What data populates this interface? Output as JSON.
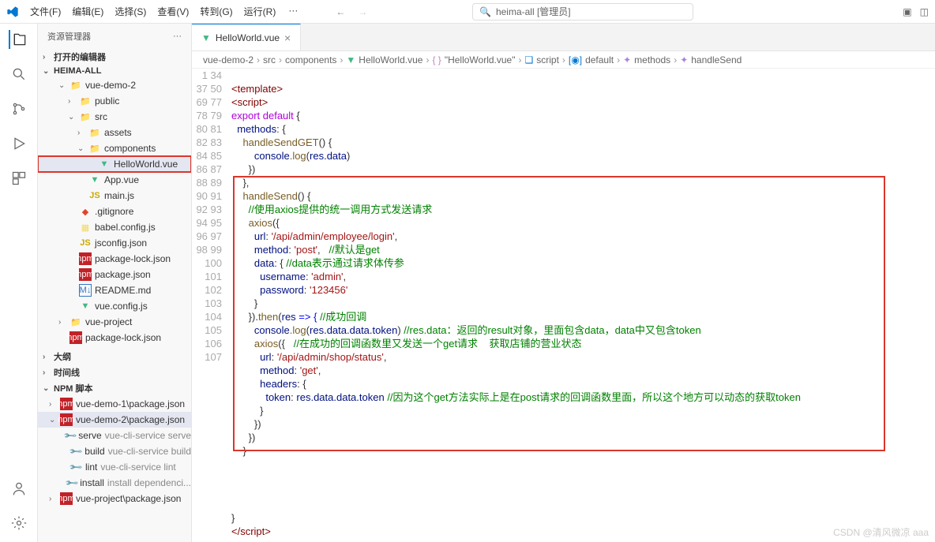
{
  "menu": {
    "file": "文件(F)",
    "edit": "编辑(E)",
    "select": "选择(S)",
    "view": "查看(V)",
    "goto": "转到(G)",
    "run": "运行(R)"
  },
  "search_box": "heima-all [管理员]",
  "sidebar": {
    "title": "资源管理器",
    "opened": "打开的编辑器",
    "project": "HEIMA-ALL",
    "outline": "大纲",
    "timeline": "时间线",
    "npm_scripts": "NPM 脚本",
    "tree": {
      "vue_demo_2": "vue-demo-2",
      "public": "public",
      "src": "src",
      "assets": "assets",
      "components": "components",
      "helloworld": "HelloWorld.vue",
      "app_vue": "App.vue",
      "main_js": "main.js",
      "gitignore": ".gitignore",
      "babel": "babel.config.js",
      "jsconfig": "jsconfig.json",
      "pkg_lock": "package-lock.json",
      "pkg": "package.json",
      "readme": "README.md",
      "vue_config": "vue.config.js",
      "vue_project": "vue-project",
      "pkg_lock2": "package-lock.json"
    },
    "npm": {
      "pkg1": "vue-demo-1\\package.json",
      "pkg2": "vue-demo-2\\package.json",
      "serve": "serve",
      "serve_d": "vue-cli-service serve",
      "build": "build",
      "build_d": "vue-cli-service build",
      "lint": "lint",
      "lint_d": "vue-cli-service lint",
      "install": "install",
      "install_d": "install dependenci...",
      "pkg3": "vue-project\\package.json"
    }
  },
  "tab": {
    "name": "HelloWorld.vue"
  },
  "breadcrumb": {
    "p1": "vue-demo-2",
    "p2": "src",
    "p3": "components",
    "p4": "HelloWorld.vue",
    "p5": "\"HelloWorld.vue\"",
    "p6": "script",
    "p7": "default",
    "p8": "methods",
    "p9": "handleSend"
  },
  "code": {
    "lines": [
      1,
      34,
      37,
      50,
      69,
      77,
      78,
      79,
      80,
      81,
      82,
      83,
      84,
      85,
      86,
      87,
      88,
      89,
      90,
      91,
      92,
      93,
      94,
      95,
      96,
      97,
      98,
      99,
      100,
      101,
      102,
      103,
      104,
      105,
      106,
      107
    ],
    "l1": "<template>",
    "l34": "<script>",
    "l37a": "export",
    "l37b": " default",
    "l37c": " {",
    "l50a": "  methods",
    "l50b": ": {",
    "l69a": "    handleSendGET",
    "l69b": "() {",
    "l77a": "        console",
    "l77b": ".log",
    "l77c": "(",
    "l77d": "res",
    "l77e": ".data",
    "l77f": ")",
    "l78": "      })",
    "l79": "    },",
    "l80a": "    handleSend",
    "l80b": "() {",
    "l81": "      //使用axios提供的统一调用方式发送请求",
    "l82a": "      axios",
    "l82b": "({",
    "l83a": "        url",
    "l83b": ": ",
    "l83c": "'/api/admin/employee/login'",
    "l83d": ",",
    "l84a": "        method",
    "l84b": ": ",
    "l84c": "'post'",
    "l84d": ",   ",
    "l84e": "//默认是get",
    "l85a": "        data",
    "l85b": ": { ",
    "l85c": "//data表示通过请求体传参",
    "l86a": "          username",
    "l86b": ": ",
    "l86c": "'admin'",
    "l86d": ",",
    "l87a": "          password",
    "l87b": ": ",
    "l87c": "'123456'",
    "l88": "        }",
    "l89a": "      }).",
    "l89b": "then",
    "l89c": "(",
    "l89d": "res",
    "l89e": " => { ",
    "l89f": "//成功回调",
    "l90a": "        console",
    "l90b": ".log",
    "l90c": "(",
    "l90d": "res",
    "l90e": ".data.data.token",
    "l90f": ") ",
    "l90g": "//res.data：返回的result对象，里面包含data，data中又包含token",
    "l91a": "        axios",
    "l91b": "({   ",
    "l91c": "//在成功的回调函数里又发送一个get请求    获取店铺的营业状态",
    "l92a": "          url",
    "l92b": ": ",
    "l92c": "'/api/admin/shop/status'",
    "l92d": ",",
    "l93a": "          method",
    "l93b": ": ",
    "l93c": "'get'",
    "l93d": ",",
    "l94a": "          headers",
    "l94b": ": {",
    "l95a": "            token",
    "l95b": ": ",
    "l95c": "res",
    "l95d": ".data.data.token ",
    "l95e": "//因为这个get方法实际上是在post请求的回调函数里面，所以这个地方可以动态的获取token",
    "l96": "          }",
    "l97": "        })",
    "l98": "      })",
    "l99": "    }",
    "l105": "}",
    "l106": "</scr"
  },
  "watermark": "CSDN @清风微凉 aaa"
}
